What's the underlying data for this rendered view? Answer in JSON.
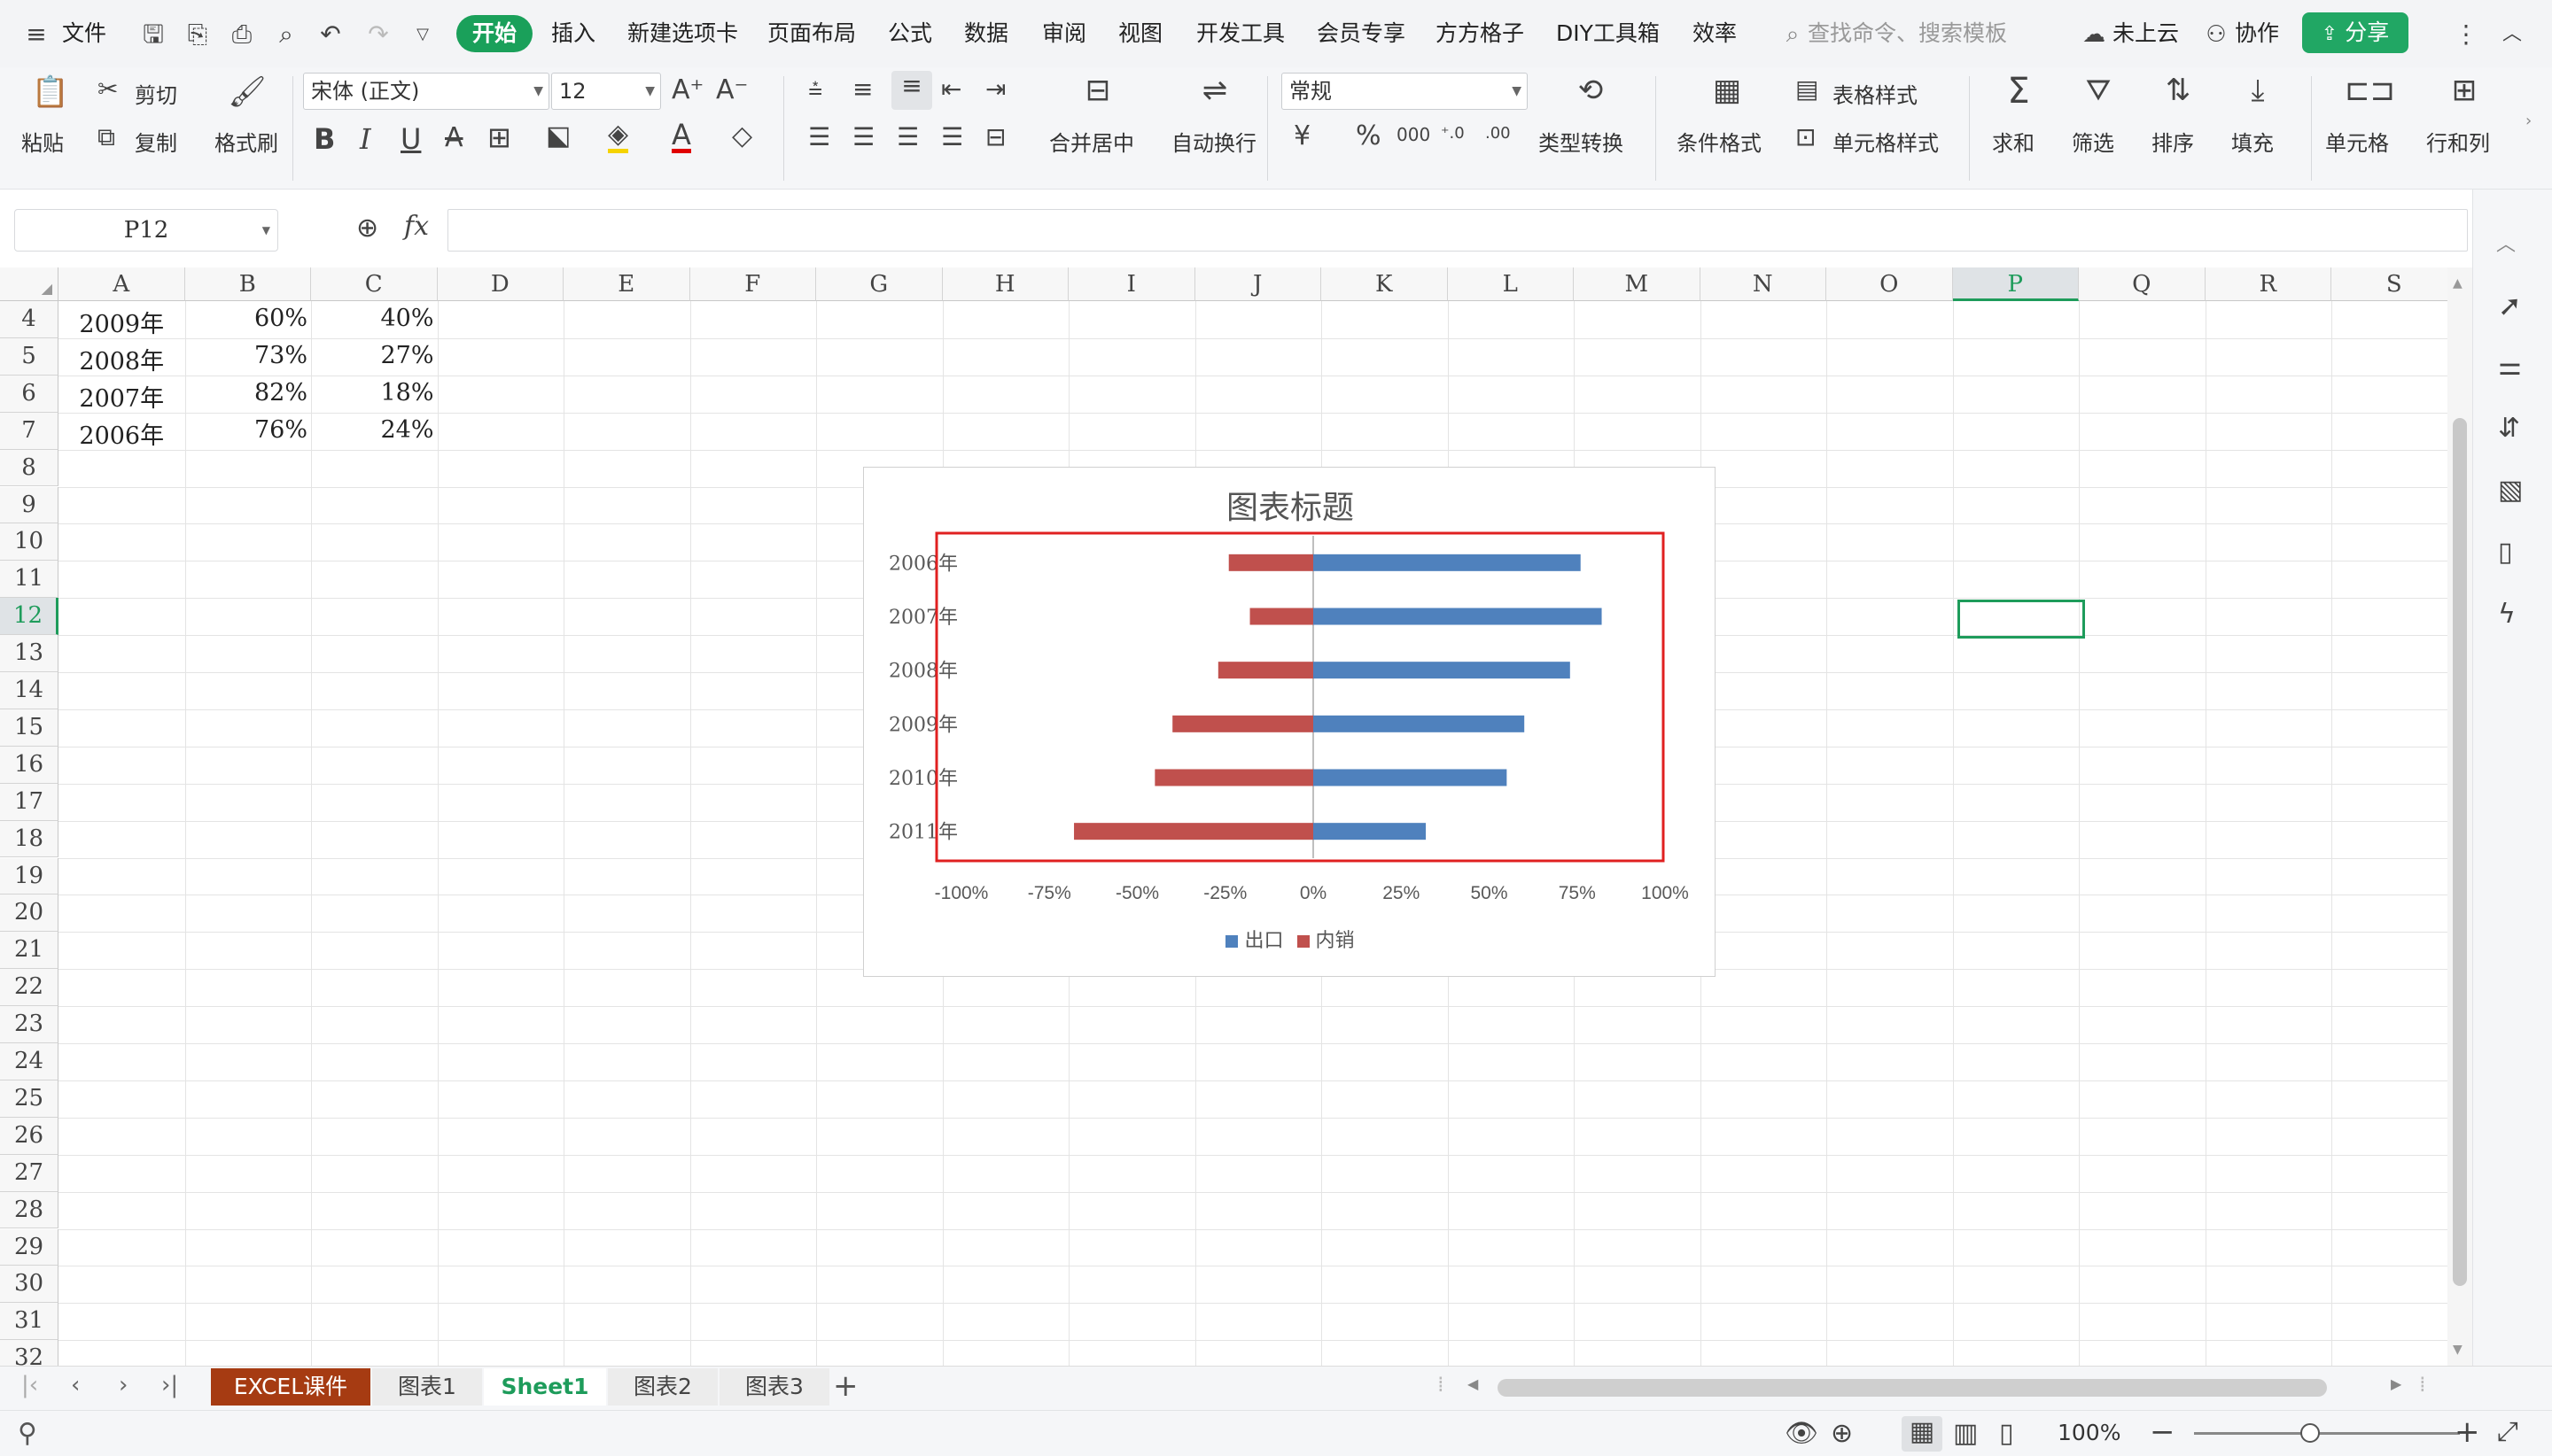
{
  "menu": {
    "file": "文件",
    "tabs": [
      "开始",
      "插入",
      "新建选项卡",
      "页面布局",
      "公式",
      "数据",
      "审阅",
      "视图",
      "开发工具",
      "会员专享",
      "方方格子",
      "DIY工具箱",
      "效率"
    ],
    "search_placeholder": "查找命令、搜索模板",
    "cloud": "未上云",
    "collab": "协作",
    "share": "分享"
  },
  "ribbon": {
    "paste": "粘贴",
    "cut": "剪切",
    "copy": "复制",
    "format_painter": "格式刷",
    "font_name": "宋体 (正文)",
    "font_size": "12",
    "merge_center": "合并居中",
    "wrap_text": "自动换行",
    "number_format": "常规",
    "type_convert": "类型转换",
    "cond_format": "条件格式",
    "table_style": "表格样式",
    "cell_style": "单元格样式",
    "sum": "求和",
    "filter": "筛选",
    "sort": "排序",
    "fill": "填充",
    "cells": "单元格",
    "rows_cols": "行和列"
  },
  "formula_bar": {
    "name_box": "P12",
    "fx": "fx",
    "content": ""
  },
  "sheet": {
    "columns": [
      "A",
      "B",
      "C",
      "D",
      "E",
      "F",
      "G",
      "H",
      "I",
      "J",
      "K",
      "L",
      "M",
      "N",
      "O",
      "P",
      "Q",
      "R",
      "S"
    ],
    "first_row": 4,
    "last_row": 32,
    "selected_cell": "P12",
    "rows": [
      {
        "row": 4,
        "a": "2009年",
        "b": "60%",
        "c": "40%"
      },
      {
        "row": 5,
        "a": "2008年",
        "b": "73%",
        "c": "27%"
      },
      {
        "row": 6,
        "a": "2007年",
        "b": "82%",
        "c": "18%"
      },
      {
        "row": 7,
        "a": "2006年",
        "b": "76%",
        "c": "24%"
      }
    ]
  },
  "chart_data": {
    "type": "bar",
    "orientation": "horizontal",
    "title": "图表标题",
    "categories": [
      "2006年",
      "2007年",
      "2008年",
      "2009年",
      "2010年",
      "2011年"
    ],
    "series": [
      {
        "name": "出口",
        "color": "#4f81bd",
        "values": [
          76,
          82,
          73,
          60,
          55,
          32
        ]
      },
      {
        "name": "内销",
        "color": "#c0504d",
        "values": [
          -24,
          -18,
          -27,
          -40,
          -45,
          -68
        ]
      }
    ],
    "x_ticks": [
      "-100%",
      "-75%",
      "-50%",
      "-25%",
      "0%",
      "25%",
      "50%",
      "75%",
      "100%"
    ],
    "xlim": [
      -100,
      100
    ],
    "legend_position": "bottom",
    "plot_area_highlight_color": "#e02020"
  },
  "sheet_tabs": [
    "EXCEL课件",
    "图表1",
    "Sheet1",
    "图表2",
    "图表3"
  ],
  "active_sheet_tab": "Sheet1",
  "status": {
    "zoom": "100%"
  }
}
